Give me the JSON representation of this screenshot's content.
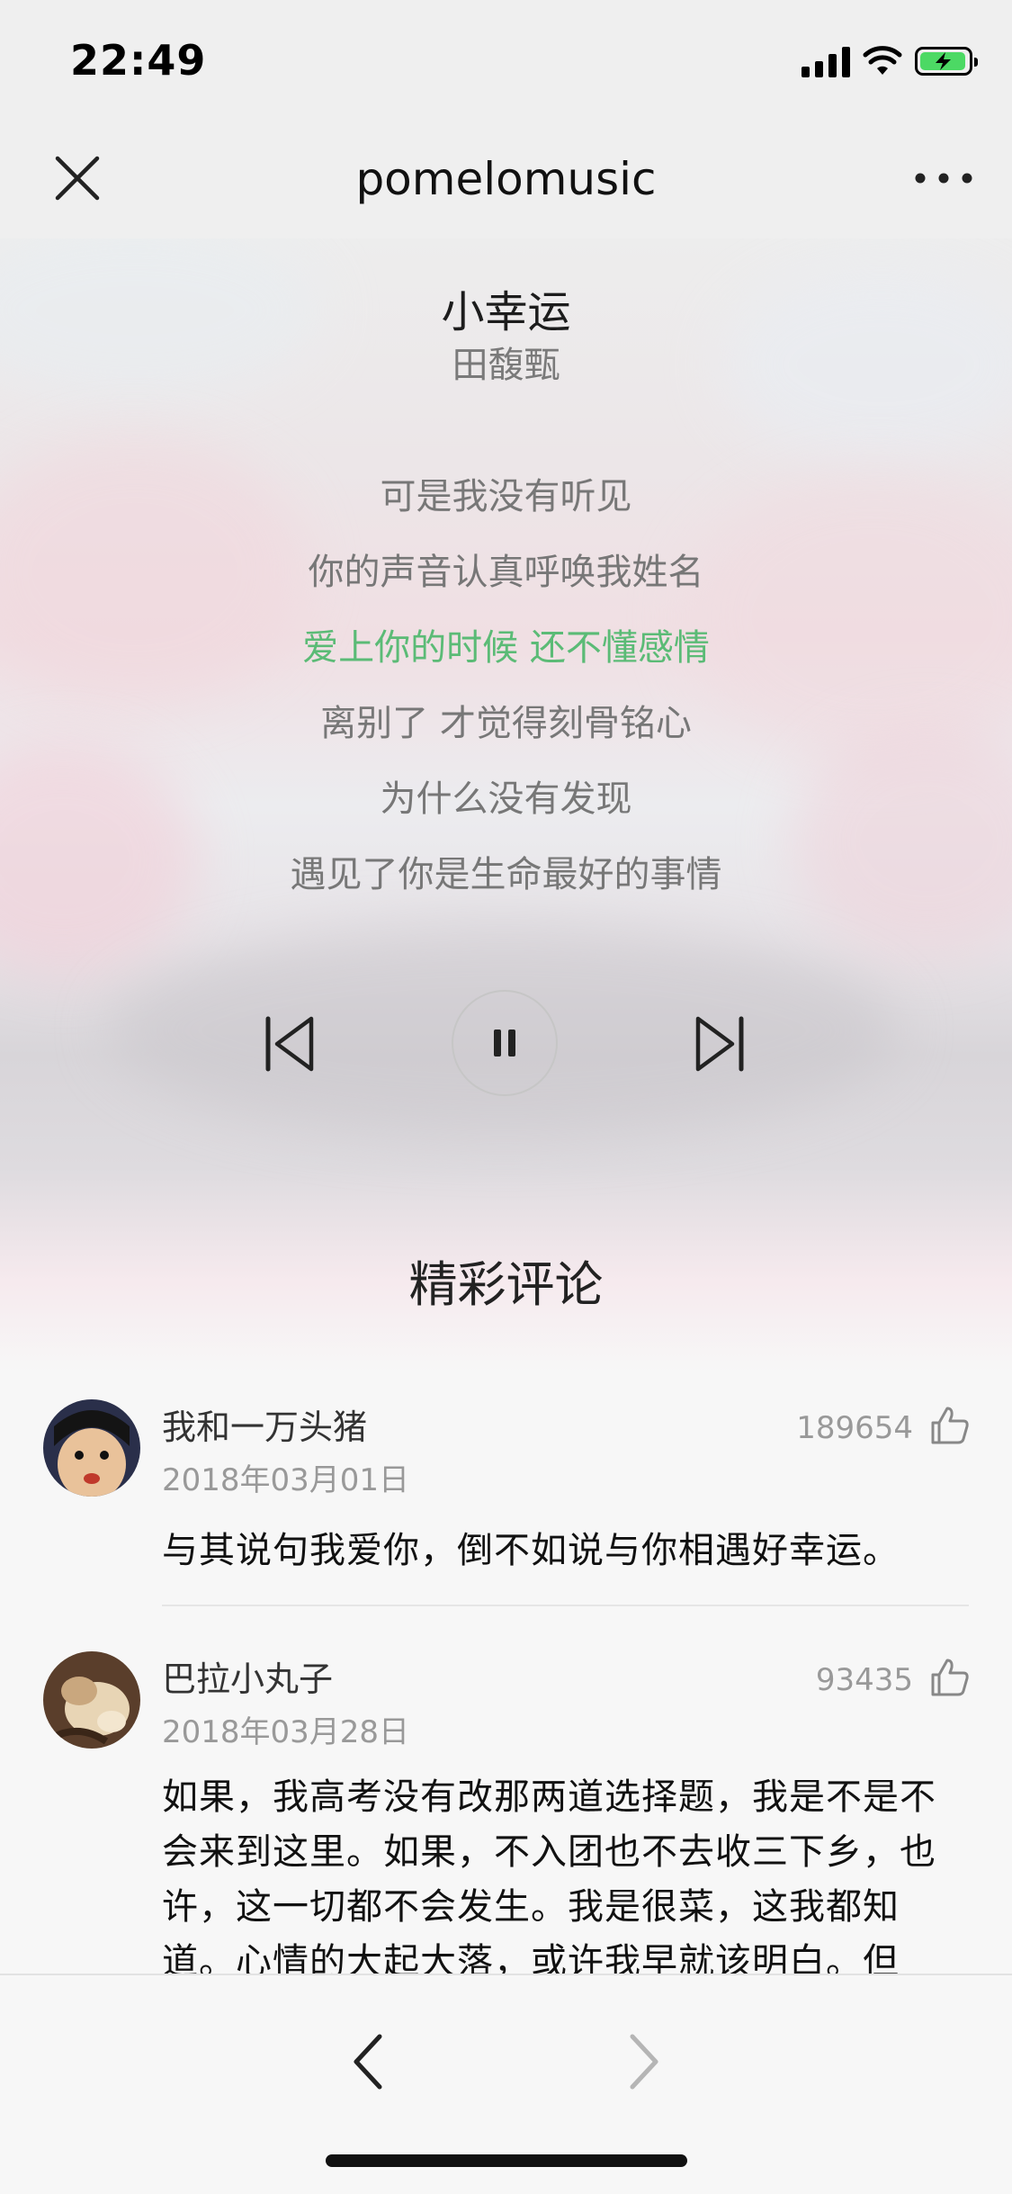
{
  "status": {
    "time": "22:49",
    "icons": [
      "signal-icon",
      "wifi-icon",
      "battery-charging-icon"
    ]
  },
  "nav": {
    "title": "pomelomusic",
    "close_icon": "close-icon",
    "more_icon": "more-icon"
  },
  "player": {
    "song_title": "小幸运",
    "artist": "田馥甄",
    "lyrics": [
      "可是我没有听见",
      "你的声音认真呼唤我姓名",
      "爱上你的时候 还不懂感情",
      "离别了 才觉得刻骨铭心",
      "为什么没有发现",
      "遇见了你是生命最好的事情"
    ],
    "active_lyric_index": 2,
    "active_color": "#5bbb76",
    "controls": [
      "previous-icon",
      "pause-icon",
      "next-icon"
    ]
  },
  "comments_section": {
    "title": "精彩评论",
    "comments": [
      {
        "user": "我和一万头猪",
        "date": "2018年03月01日",
        "likes": "189654",
        "text": "与其说句我爱你，倒不如说与你相遇好幸运。"
      },
      {
        "user": "巴拉小丸子",
        "date": "2018年03月28日",
        "likes": "93435",
        "text": "如果，我高考没有改那两道选择题，我是不是不会来到这里。如果，不入团也不去收三下乡，也许，这一切都不会发生。我是很菜，这我都知道。心情的大起大落，或许我早就该明白。但"
      }
    ]
  },
  "toolbar": {
    "back_icon": "back-chevron-icon",
    "forward_icon": "forward-chevron-icon"
  }
}
